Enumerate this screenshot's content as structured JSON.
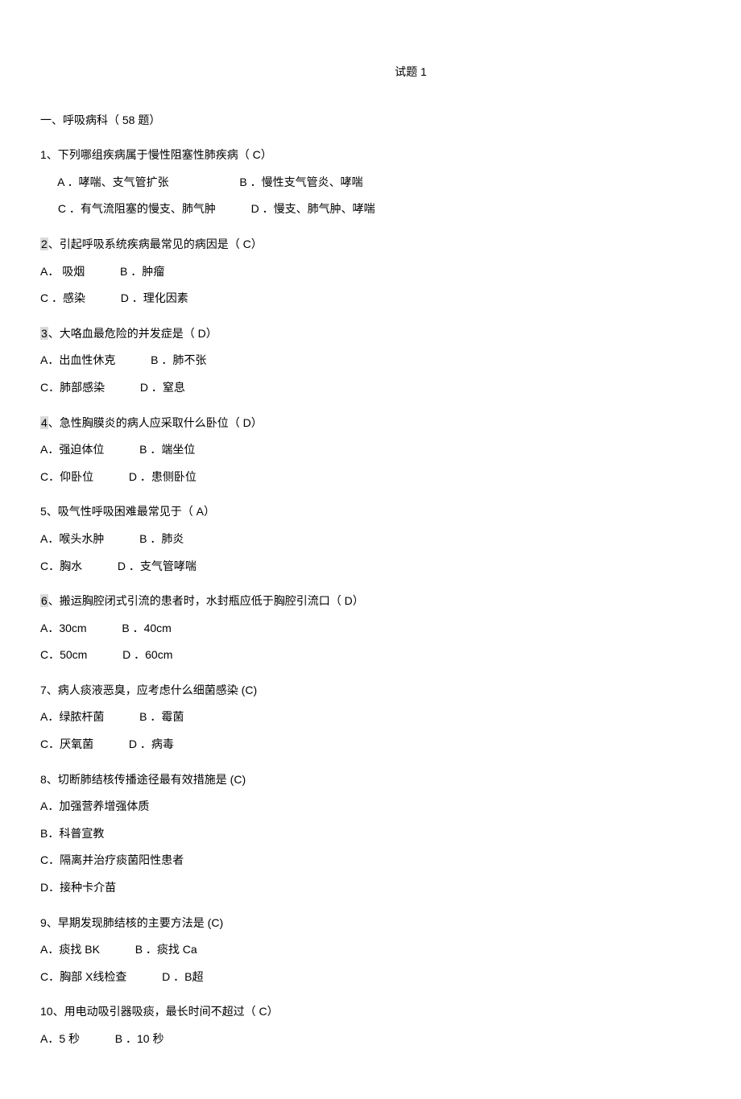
{
  "title": "试题 1",
  "section": "一、呼吸病科（ 58 题）",
  "q1": {
    "stem": "1、下列哪组疾病属于慢性阻塞性肺疾病（  C）",
    "a": "A  ．哮喘、支气管扩张",
    "b": "B      ．慢性支气管炎、哮喘",
    "c": "C  ．有气流阻塞的慢支、肺气肿",
    "d": "D   ．慢支、肺气肿、哮喘"
  },
  "q2": {
    "num_hl": "2",
    "stem_rest": "、引起呼吸系统疾病最常见的病因是（  C）",
    "a": "A．    吸烟",
    "b": "B      ．肿瘤",
    "c": "C ．感染",
    "d": "D     ．理化因素"
  },
  "q3": {
    "num_hl": "3",
    "stem_rest": "、大咯血最危险的并发症是（  D）",
    "a": "A．出血性休克",
    "b": "B   ．肺不张",
    "c": "C．肺部感染",
    "d": "D     ．窒息"
  },
  "q4": {
    "num_hl": "4",
    "stem_rest": "、急性胸膜炎的病人应采取什么卧位（  D）",
    "a": "A．强迫体位",
    "b": "B     ．端坐位",
    "c": "C．仰卧位",
    "d": "D       ．患侧卧位"
  },
  "q5": {
    "stem": "5、吸气性呼吸困难最常见于（  A）",
    "a": "A．喉头水肿",
    "b": "B    ．肺炎",
    "c": "C．胸水",
    "d": "D       ．支气管哮喘"
  },
  "q6": {
    "num_hl": "6",
    "stem_rest": "、搬运胸腔闭式引流的患者时，水封瓶应低于胸腔引流口（    D）",
    "a": "A．30cm",
    "b": "B     ．40cm",
    "c": "C．50cm",
    "d": "D     ．60cm"
  },
  "q7": {
    "stem": "7、病人痰液恶臭，应考虑什么细菌感染  (C)",
    "a": "A．绿脓杆菌",
    "b": "B    ．霉菌",
    "c": "C．厌氧菌",
    "d": "D      ．病毒"
  },
  "q8": {
    "stem": "8、切断肺结核传播途径最有效措施是  (C)",
    "a": "A．加强营养增强体质",
    "b": "B．科普宣教",
    "c": "C．隔离并治疗痰菌阳性患者",
    "d": "D．接种卡介苗"
  },
  "q9": {
    "stem": "9、早期发现肺结核的主要方法是  (C)",
    "a": "A．痰找 BK",
    "b": "B      ．痰找 Ca",
    "c": "C．胸部  X线检查",
    "d": "D  ．B超"
  },
  "q10": {
    "stem": "10、用电动吸引器吸痰，最长时间不超过（  C）",
    "a": "A．5 秒",
    "b": "B       ．10 秒"
  }
}
